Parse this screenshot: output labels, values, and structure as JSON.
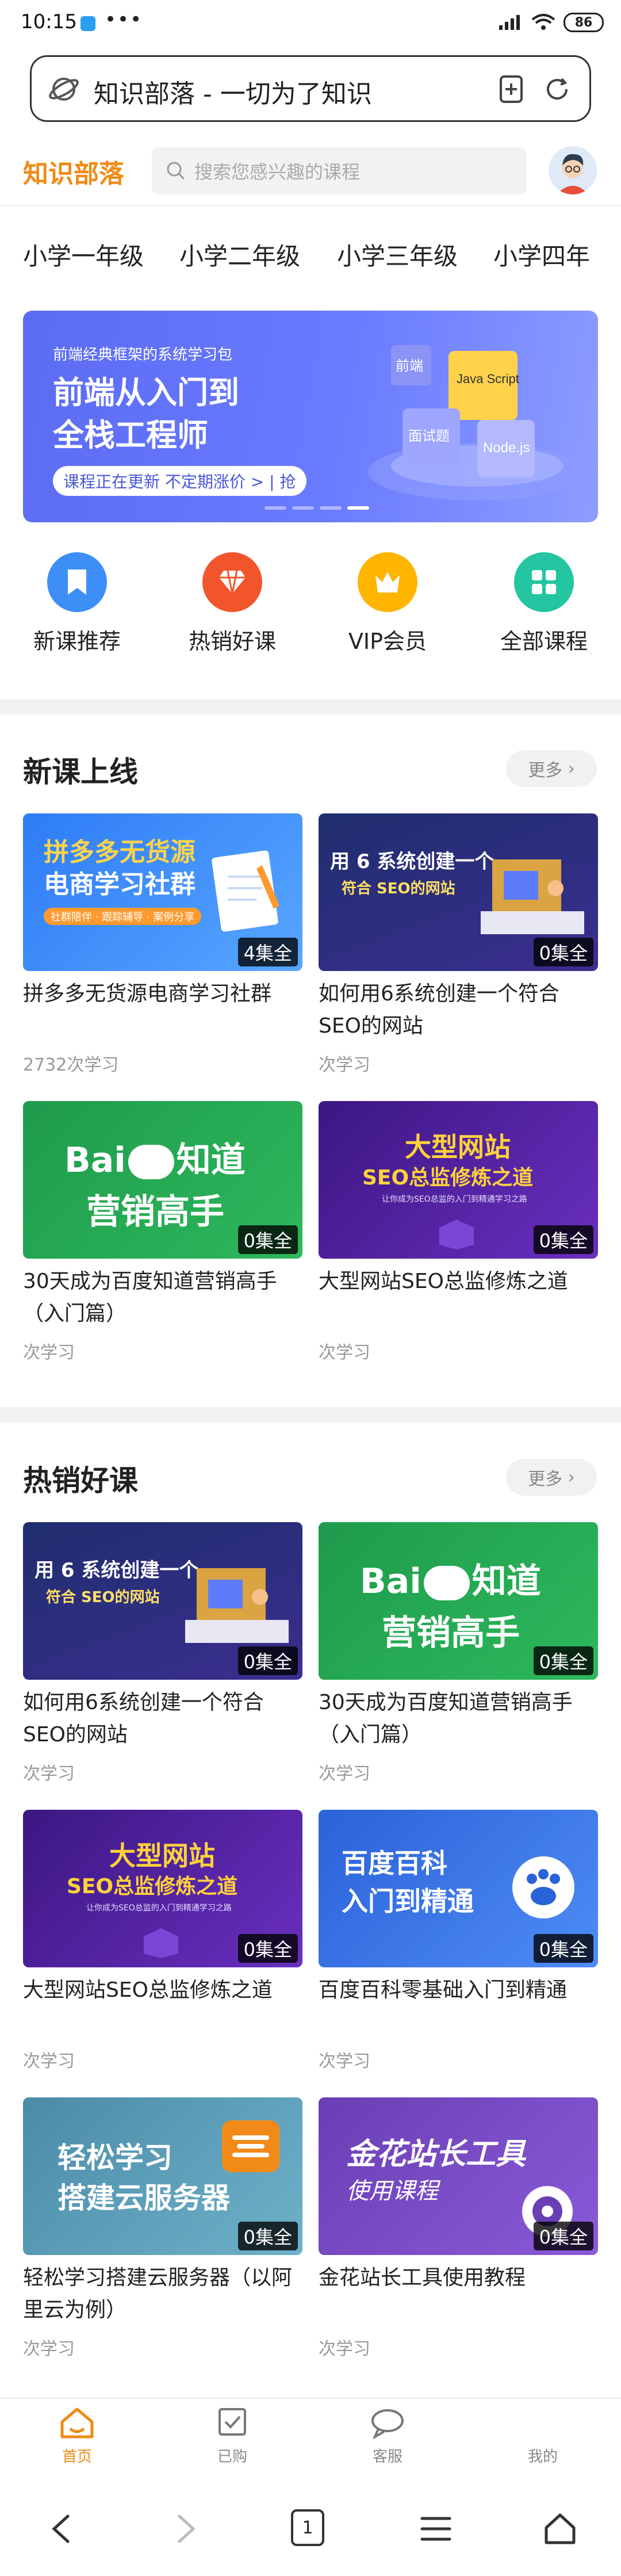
{
  "status": {
    "time": "10:15",
    "battery": "86"
  },
  "browser": {
    "page_title": "知识部落 - 一切为了知识"
  },
  "app": {
    "logo": "知识部落",
    "search_placeholder": "搜索您感兴趣的课程"
  },
  "grades": [
    "小学一年级",
    "小学二年级",
    "小学三年级",
    "小学四年"
  ],
  "banner": {
    "subtitle": "前端经典框架的系统学习包",
    "headline_1": "前端从入门到",
    "headline_2": "全栈工程师",
    "pill": "课程正在更新 不定期涨价 > | 抢",
    "cube_labels": [
      "前端",
      "Java Script",
      "面试题",
      "Node.js"
    ]
  },
  "quick_nav": [
    {
      "label": "新课推荐",
      "icon": "bookmark-icon",
      "color": "#3d8ef7"
    },
    {
      "label": "热销好课",
      "icon": "gem-icon",
      "color": "#f2552c"
    },
    {
      "label": "VIP会员",
      "icon": "crown-icon",
      "color": "#ffb400"
    },
    {
      "label": "全部课程",
      "icon": "grid-icon",
      "color": "#23c6a0"
    }
  ],
  "sections": {
    "new": {
      "title": "新课上线",
      "more": "更多"
    },
    "hot": {
      "title": "热销好课",
      "more": "更多"
    }
  },
  "new_courses": [
    {
      "title": "拼多多无货源电商学习社群",
      "count": "4集全",
      "meta": "2732次学习",
      "thumb_1": "拼多多无货源",
      "thumb_2": "电商学习社群",
      "thumb_3": "社群陪伴 · 跟踪辅导 · 案例分享"
    },
    {
      "title": "如何用6系统创建一个符合SEO的网站",
      "count": "0集全",
      "meta": "次学习",
      "thumb_1": "用 6 系统创建一个",
      "thumb_2": "符合 SEO的网站"
    },
    {
      "title": "30天成为百度知道营销高手（入门篇）",
      "count": "0集全",
      "meta": "次学习",
      "thumb_1": "Bai",
      "thumb_2": "知道",
      "thumb_3": "营销高手"
    },
    {
      "title": "大型网站SEO总监修炼之道",
      "count": "0集全",
      "meta": "次学习",
      "thumb_1": "大型网站",
      "thumb_2": "SEO总监修炼之道",
      "thumb_3": "让你成为SEO总监的入门到精通学习之路"
    }
  ],
  "hot_courses": [
    {
      "title": "如何用6系统创建一个符合SEO的网站",
      "count": "0集全",
      "meta": "次学习",
      "thumb_1": "用 6 系统创建一个",
      "thumb_2": "符合 SEO的网站"
    },
    {
      "title": "30天成为百度知道营销高手（入门篇）",
      "count": "0集全",
      "meta": "次学习",
      "thumb_1": "Bai",
      "thumb_2": "知道",
      "thumb_3": "营销高手"
    },
    {
      "title": "大型网站SEO总监修炼之道",
      "count": "0集全",
      "meta": "次学习",
      "thumb_1": "大型网站",
      "thumb_2": "SEO总监修炼之道",
      "thumb_3": "让你成为SEO总监的入门到精通学习之路"
    },
    {
      "title": "百度百科零基础入门到精通",
      "count": "0集全",
      "meta": "次学习",
      "thumb_1": "百度百科",
      "thumb_2": "入门到精通"
    },
    {
      "title": "轻松学习搭建云服务器（以阿里云为例）",
      "count": "0集全",
      "meta": "次学习",
      "thumb_1": "轻松学习",
      "thumb_2": "搭建云服务器"
    },
    {
      "title": "金花站长工具使用教程",
      "count": "0集全",
      "meta": "次学习",
      "thumb_1": "金花站长工具",
      "thumb_2": "使用课程"
    }
  ],
  "tabbar": [
    {
      "label": "首页",
      "active": true
    },
    {
      "label": "已购",
      "active": false
    },
    {
      "label": "客服",
      "active": false
    },
    {
      "label": "我的",
      "active": false
    }
  ],
  "system_nav": {
    "tab_count": "1"
  }
}
